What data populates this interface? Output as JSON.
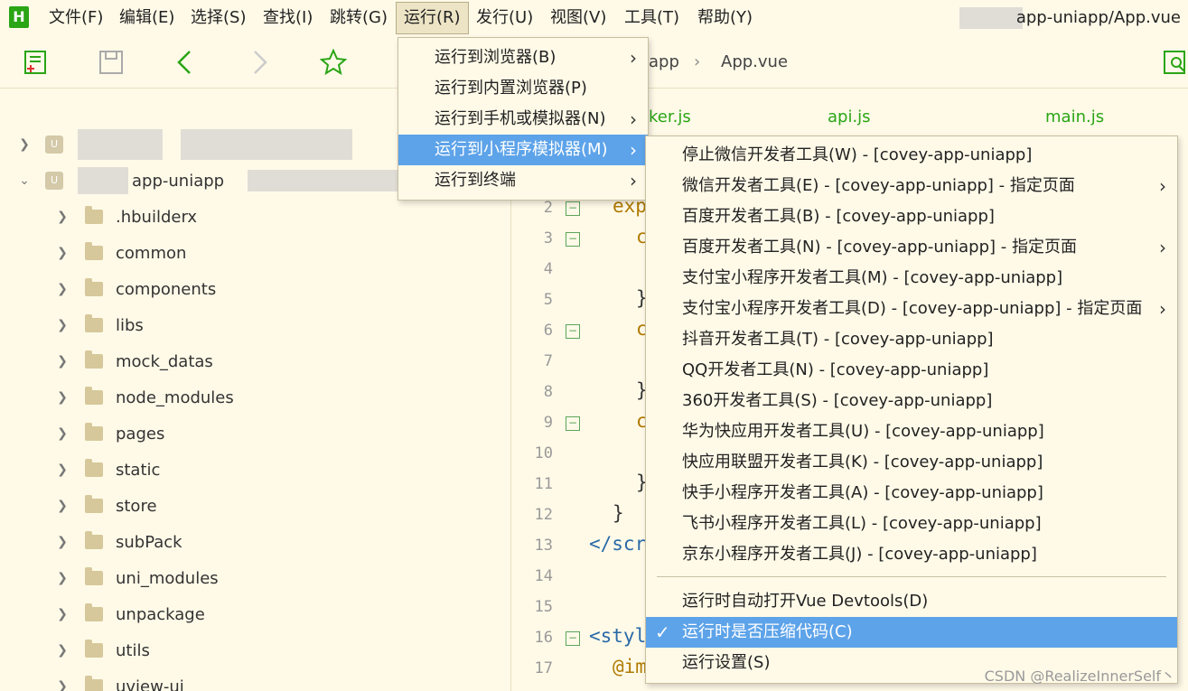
{
  "app": {
    "logo": "H",
    "window_title": "app-uniapp/App.vue",
    "accent": "#2aa515",
    "highlight": "#5da3e9"
  },
  "menubar": [
    {
      "label": "文件(F)"
    },
    {
      "label": "编辑(E)"
    },
    {
      "label": "选择(S)"
    },
    {
      "label": "查找(I)"
    },
    {
      "label": "跳转(G)"
    },
    {
      "label": "运行(R)"
    },
    {
      "label": "发行(U)"
    },
    {
      "label": "视图(V)"
    },
    {
      "label": "工具(T)"
    },
    {
      "label": "帮助(Y)"
    }
  ],
  "toolbar": {
    "icons": [
      "new-file-icon",
      "save-icon",
      "back-icon",
      "forward-icon",
      "star-icon",
      "search-icon"
    ],
    "breadcrumb": [
      "app",
      "App.vue"
    ]
  },
  "sidebar": {
    "projects": [
      {
        "name": ""
      },
      {
        "name": "app-uniapp"
      }
    ],
    "folders": [
      ".hbuilderx",
      "common",
      "components",
      "libs",
      "mock_datas",
      "node_modules",
      "pages",
      "static",
      "store",
      "subPack",
      "uni_modules",
      "unpackage",
      "utils",
      "uview-ui"
    ]
  },
  "editor": {
    "tabs": [
      "ker.js",
      "api.js",
      "main.js"
    ],
    "line_numbers": [
      "2",
      "3",
      "4",
      "5",
      "6",
      "7",
      "8",
      "9",
      "10",
      "11",
      "12",
      "13",
      "14",
      "15",
      "16",
      "17"
    ],
    "code_lines": {
      "l2": "exp",
      "l3": "c",
      "l5": "}",
      "l6": "c",
      "l8": "}",
      "l9": "c",
      "l11": "}",
      "l12": "}",
      "l13": "</scr",
      "l16": "<styl",
      "l17": "@im"
    }
  },
  "run_menu": {
    "items": [
      {
        "label": "运行到浏览器(B)",
        "submenu": true
      },
      {
        "label": "运行到内置浏览器(P)",
        "submenu": false
      },
      {
        "label": "运行到手机或模拟器(N)",
        "submenu": true
      },
      {
        "label": "运行到小程序模拟器(M)",
        "submenu": true,
        "highlighted": true
      },
      {
        "label": "运行到终端",
        "submenu": true
      }
    ]
  },
  "miniprogram_menu": {
    "items": [
      {
        "label": "停止微信开发者工具(W) - [covey-app-uniapp]",
        "submenu": false
      },
      {
        "label": "微信开发者工具(E) - [covey-app-uniapp] - 指定页面",
        "submenu": true
      },
      {
        "label": "百度开发者工具(B) - [covey-app-uniapp]",
        "submenu": false
      },
      {
        "label": "百度开发者工具(N) - [covey-app-uniapp] - 指定页面",
        "submenu": true
      },
      {
        "label": "支付宝小程序开发者工具(M) - [covey-app-uniapp]",
        "submenu": false
      },
      {
        "label": "支付宝小程序开发者工具(D) - [covey-app-uniapp] - 指定页面",
        "submenu": true
      },
      {
        "label": "抖音开发者工具(T) - [covey-app-uniapp]",
        "submenu": false
      },
      {
        "label": "QQ开发者工具(N) - [covey-app-uniapp]",
        "submenu": false
      },
      {
        "label": "360开发者工具(S) - [covey-app-uniapp]",
        "submenu": false
      },
      {
        "label": "华为快应用开发者工具(U) - [covey-app-uniapp]",
        "submenu": false
      },
      {
        "label": "快应用联盟开发者工具(K) - [covey-app-uniapp]",
        "submenu": false
      },
      {
        "label": "快手小程序开发者工具(A) - [covey-app-uniapp]",
        "submenu": false
      },
      {
        "label": "飞书小程序开发者工具(L) - [covey-app-uniapp]",
        "submenu": false
      },
      {
        "label": "京东小程序开发者工具(J) - [covey-app-uniapp]",
        "submenu": false
      }
    ],
    "options": [
      {
        "label": "运行时自动打开Vue Devtools(D)",
        "checked": false
      },
      {
        "label": "运行时是否压缩代码(C)",
        "checked": true,
        "highlighted": true
      },
      {
        "label": "运行设置(S)",
        "checked": false
      }
    ]
  },
  "watermark": "CSDN @RealizeInnerSelf丶"
}
